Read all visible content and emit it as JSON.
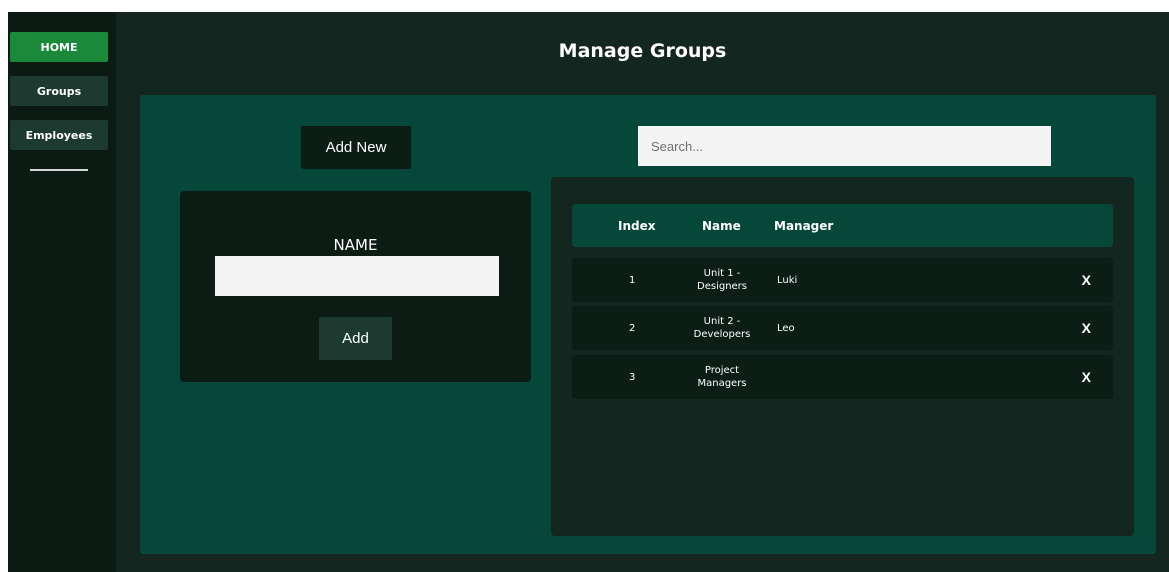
{
  "nav": {
    "items": [
      {
        "label": "HOME"
      },
      {
        "label": "Groups"
      },
      {
        "label": "Employees"
      }
    ]
  },
  "header": {
    "title": "Manage Groups"
  },
  "toolbar": {
    "add_new_label": "Add New"
  },
  "search": {
    "placeholder": "Search...",
    "value": ""
  },
  "form": {
    "name_label": "NAME",
    "name_value": "",
    "add_label": "Add"
  },
  "table": {
    "headers": [
      "Index",
      "Name",
      "Manager"
    ],
    "rows": [
      {
        "index": "1",
        "name": "Unit 1 - Designers",
        "manager": "Luki",
        "delete": "X"
      },
      {
        "index": "2",
        "name": "Unit 2 - Developers",
        "manager": "Leo",
        "delete": "X"
      },
      {
        "index": "3",
        "name": "Project Managers",
        "manager": "",
        "delete": "X"
      }
    ]
  },
  "colors": {
    "accent": "#1a8a3a",
    "panel": "#05483a",
    "background": "#142620",
    "sidebar": "#0c1a14"
  }
}
